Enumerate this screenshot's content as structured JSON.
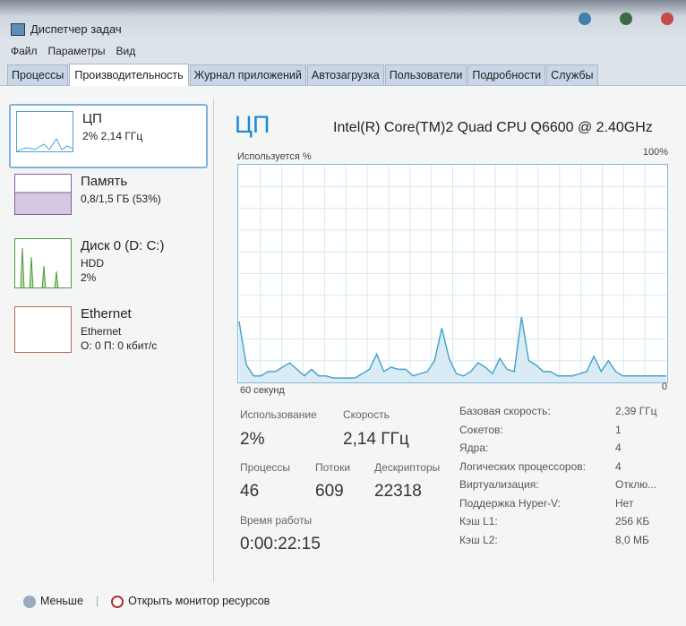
{
  "window": {
    "title": "Диспетчер задач"
  },
  "menu": [
    "Файл",
    "Параметры",
    "Вид"
  ],
  "tabs": [
    "Процессы",
    "Производительность",
    "Журнал приложений",
    "Автозагрузка",
    "Пользователи",
    "Подробности",
    "Службы"
  ],
  "sidebar": [
    {
      "name": "ЦП",
      "sub1": "2% 2,14 ГГц",
      "sub2": "",
      "sub3": ""
    },
    {
      "name": "Память",
      "sub1": "0,8/1,5 ГБ (53%)",
      "sub2": "",
      "sub3": ""
    },
    {
      "name": "Диск 0 (D: C:)",
      "sub1": "HDD",
      "sub2": "2%",
      "sub3": ""
    },
    {
      "name": "Ethernet",
      "sub1": "Ethernet",
      "sub2": "О: 0 П: 0 кбит/с",
      "sub3": ""
    }
  ],
  "main": {
    "title": "ЦП",
    "model": "Intel(R) Core(TM)2 Quad CPU Q6600 @ 2.40GHz",
    "usage_label": "Используется %",
    "max_label": "100%",
    "time_label": "60 секунд",
    "min_label": "0",
    "stats": {
      "usage_l": "Использование",
      "usage_v": "2%",
      "speed_l": "Скорость",
      "speed_v": "2,14 ГГц",
      "proc_l": "Процессы",
      "proc_v": "46",
      "threads_l": "Потоки",
      "threads_v": "609",
      "handles_l": "Дескрипторы",
      "handles_v": "22318",
      "uptime_l": "Время работы",
      "uptime_v": "0:00:22:15"
    },
    "info": [
      [
        "Базовая скорость:",
        "2,39 ГГц"
      ],
      [
        "Сокетов:",
        "1"
      ],
      [
        "Ядра:",
        "4"
      ],
      [
        "Логических процессоров:",
        "4"
      ],
      [
        "Виртуализация:",
        "Отклю..."
      ],
      [
        "Поддержка Hyper-V:",
        "Нет"
      ],
      [
        "Кэш L1:",
        "256 КБ"
      ],
      [
        "Кэш L2:",
        "8,0 МБ"
      ]
    ]
  },
  "footer": {
    "less": "Меньше",
    "monitor": "Открыть монитор ресурсов"
  },
  "chart_data": {
    "type": "area",
    "ylim": [
      0,
      100
    ],
    "xlabel": "60 секунд",
    "ylabel": "Используется %",
    "values": [
      28,
      8,
      3,
      3,
      5,
      5,
      7,
      9,
      6,
      3,
      6,
      3,
      3,
      2,
      2,
      2,
      2,
      4,
      6,
      13,
      5,
      7,
      6,
      6,
      3,
      4,
      5,
      10,
      25,
      11,
      4,
      3,
      5,
      9,
      7,
      4,
      11,
      6,
      5,
      30,
      10,
      8,
      5,
      5,
      3,
      3,
      3,
      4,
      5,
      12,
      5,
      10,
      5,
      3,
      3,
      3,
      3,
      3,
      3,
      3
    ]
  },
  "colors": {
    "accent": "#1b8ad4",
    "line": "#4aa3cf",
    "fill": "#d9ecf6"
  }
}
